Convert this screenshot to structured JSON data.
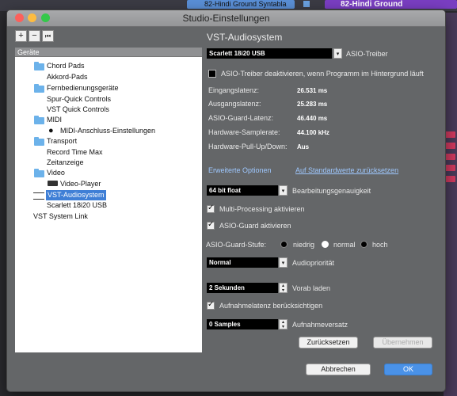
{
  "background": {
    "tab1_label": "82-Hindi Ground Syntabla",
    "tab2_label": "82-Hindi Ground"
  },
  "window": {
    "title": "Studio-Einstellungen"
  },
  "toolbar": {
    "add_label": "+",
    "remove_label": "−",
    "reset_label": "⏮"
  },
  "device_panel": {
    "header": "Geräte",
    "tree": [
      {
        "label": "Chord Pads",
        "type": "folder"
      },
      {
        "label": "Akkord-Pads",
        "type": "item"
      },
      {
        "label": "Fernbedienungsgeräte",
        "type": "folder"
      },
      {
        "label": "Spur-Quick Controls",
        "type": "item"
      },
      {
        "label": "VST Quick Controls",
        "type": "item"
      },
      {
        "label": "MIDI",
        "type": "folder"
      },
      {
        "label": "MIDI-Anschluss-Einstellungen",
        "type": "item"
      },
      {
        "label": "Transport",
        "type": "folder"
      },
      {
        "label": "Record Time Max",
        "type": "item"
      },
      {
        "label": "Zeitanzeige",
        "type": "item"
      },
      {
        "label": "Video",
        "type": "folder"
      },
      {
        "label": "Video-Player",
        "type": "item"
      },
      {
        "label": "VST-Audiosystem",
        "type": "item",
        "selected": true
      },
      {
        "label": "Scarlett 18i20 USB",
        "type": "item"
      },
      {
        "label": "VST System Link",
        "type": "item"
      }
    ]
  },
  "settings": {
    "title": "VST-Audiosystem",
    "driver_value": "Scarlett 18i20 USB",
    "driver_label": "ASIO-Treiber",
    "deactivate_label": "ASIO-Treiber deaktivieren, wenn Programm im Hintergrund läuft",
    "info": [
      {
        "label": "Eingangslatenz:",
        "value": "26.531 ms"
      },
      {
        "label": "Ausgangslatenz:",
        "value": "25.283 ms"
      },
      {
        "label": "ASIO-Guard-Latenz:",
        "value": "46.440 ms"
      },
      {
        "label": "Hardware-Samplerate:",
        "value": "44.100 kHz"
      },
      {
        "label": "Hardware-Pull-Up/Down:",
        "value": "Aus"
      }
    ],
    "advanced_tab": "Erweiterte Optionen",
    "defaults_link": "Auf Standardwerte zurücksetzen",
    "precision_value": "64 bit float",
    "precision_label": "Bearbeitungsgenauigkeit",
    "multiprocessing_label": "Multi-Processing aktivieren",
    "asioguard_label": "ASIO-Guard aktivieren",
    "asioguard_level_label": "ASIO-Guard-Stufe:",
    "level_low": "niedrig",
    "level_normal": "normal",
    "level_high": "hoch",
    "priority_value": "Normal",
    "priority_label": "Audiopriorität",
    "preload_value": "2 Sekunden",
    "preload_label": "Vorab laden",
    "latency_label": "Aufnahmelatenz berücksichtigen",
    "offset_value": "0 Samples",
    "offset_label": "Aufnahmeversatz",
    "reset_button": "Zurücksetzen",
    "apply_button": "Übernehmen"
  },
  "footer": {
    "cancel_button": "Abbrechen",
    "ok_button": "OK"
  }
}
